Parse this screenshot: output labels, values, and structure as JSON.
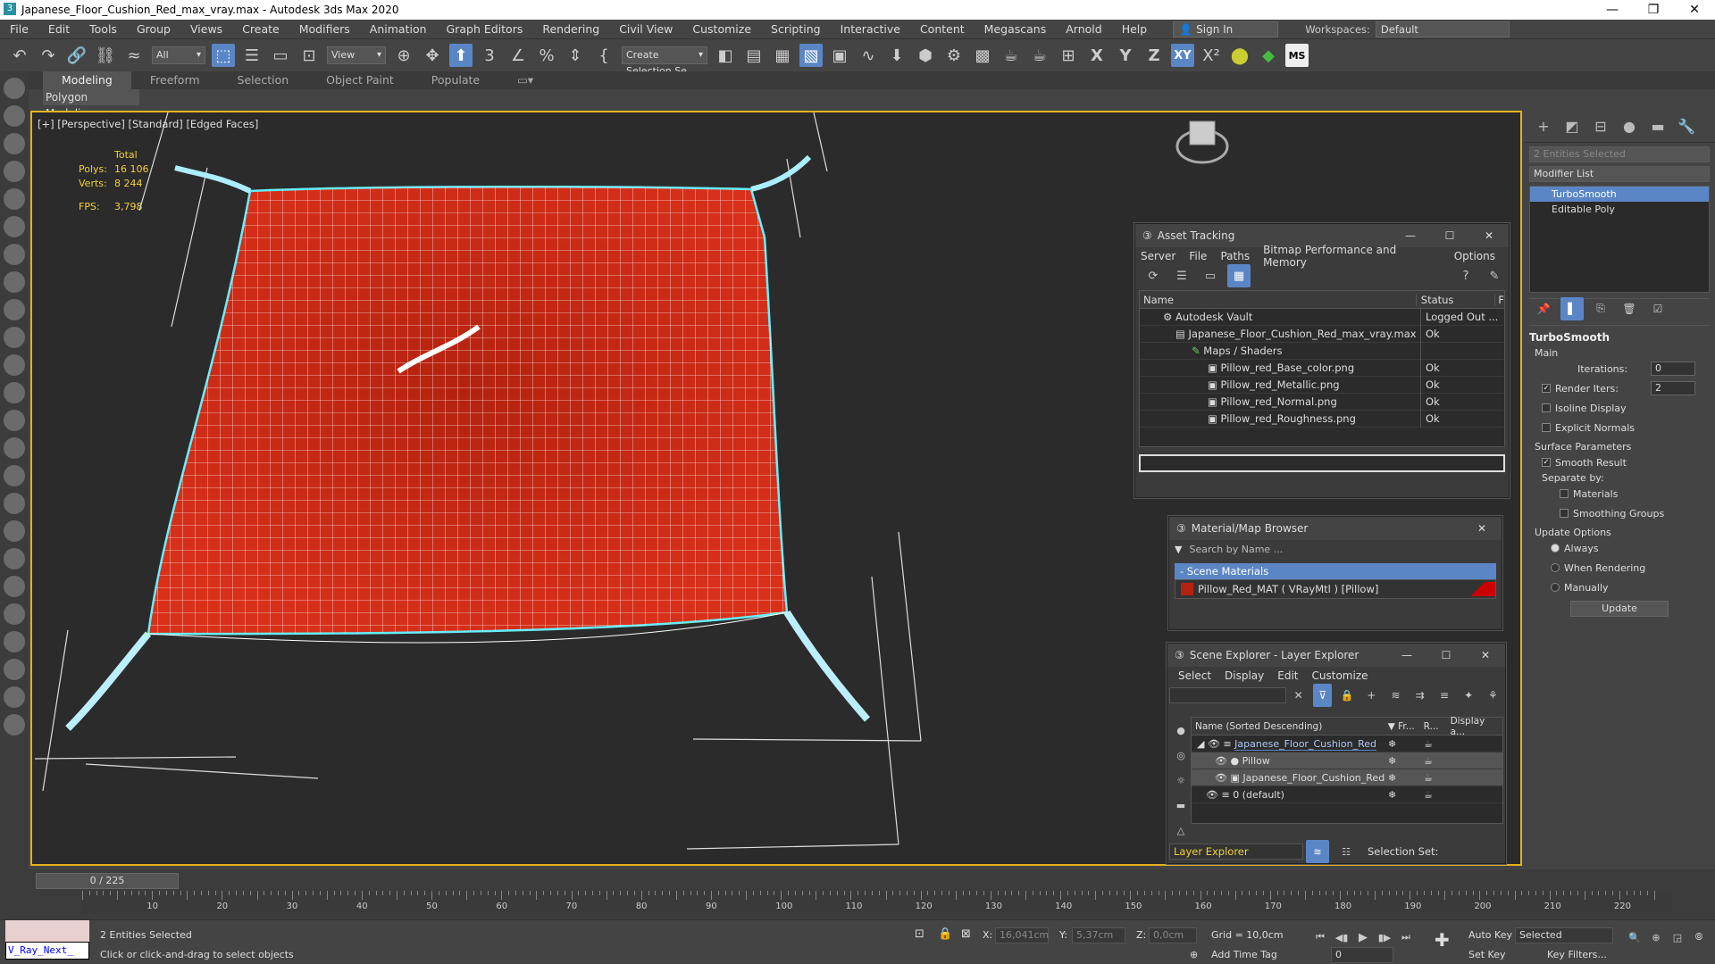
{
  "window": {
    "title": "Japanese_Floor_Cushion_Red_max_vray.max - Autodesk 3ds Max 2020"
  },
  "menu": [
    "File",
    "Edit",
    "Tools",
    "Group",
    "Views",
    "Create",
    "Modifiers",
    "Animation",
    "Graph Editors",
    "Rendering",
    "Civil View",
    "Customize",
    "Scripting",
    "Interactive",
    "Content",
    "Megascans",
    "Arnold",
    "Help"
  ],
  "signin": "Sign In",
  "workspace": {
    "label": "Workspaces:",
    "value": "Default"
  },
  "toolbar": {
    "filter": "All",
    "refcoord": "View",
    "selection_set": "Create Selection Se"
  },
  "ribbon": {
    "tabs": [
      "Modeling",
      "Freeform",
      "Selection",
      "Object Paint",
      "Populate"
    ],
    "sub": "Polygon Modeling"
  },
  "viewport": {
    "label": "[+] [Perspective] [Standard] [Edged Faces]",
    "stats": {
      "total": "Total",
      "polys_l": "Polys:",
      "polys": "16 106",
      "verts_l": "Verts:",
      "verts": "8 244",
      "fps_l": "FPS:",
      "fps": "3,798"
    }
  },
  "cmd": {
    "selected": "2 Entities Selected",
    "modlist": "Modifier List",
    "stack": [
      "TurboSmooth",
      "Editable Poly"
    ],
    "ts_title": "TurboSmooth",
    "main": "Main",
    "iterations_l": "Iterations:",
    "iterations": "0",
    "render_iters_l": "Render Iters:",
    "render_iters": "2",
    "isoline": "Isoline Display",
    "explicit": "Explicit Normals",
    "surface": "Surface Parameters",
    "smooth": "Smooth Result",
    "separate": "Separate by:",
    "materials": "Materials",
    "smoothing": "Smoothing Groups",
    "update_opts": "Update Options",
    "always": "Always",
    "when_rendering": "When Rendering",
    "manually": "Manually",
    "update": "Update"
  },
  "asset": {
    "title": "Asset Tracking",
    "menu": [
      "Server",
      "File",
      "Paths",
      "Bitmap Performance and Memory",
      "Options"
    ],
    "col_name": "Name",
    "col_status": "Status",
    "col_f": "F",
    "rows": [
      {
        "name": "Autodesk Vault",
        "status": "Logged Out ..."
      },
      {
        "name": "Japanese_Floor_Cushion_Red_max_vray.max",
        "status": "Ok"
      },
      {
        "name": "Maps / Shaders",
        "status": ""
      },
      {
        "name": "Pillow_red_Base_color.png",
        "status": "Ok"
      },
      {
        "name": "Pillow_red_Metallic.png",
        "status": "Ok"
      },
      {
        "name": "Pillow_red_Normal.png",
        "status": "Ok"
      },
      {
        "name": "Pillow_red_Roughness.png",
        "status": "Ok"
      }
    ]
  },
  "matbrowser": {
    "title": "Material/Map Browser",
    "search": "Search by Name ...",
    "group": "- Scene Materials",
    "item": "Pillow_Red_MAT ( VRayMtl ) [Pillow]"
  },
  "scene": {
    "title": "Scene Explorer - Layer Explorer",
    "menu": [
      "Select",
      "Display",
      "Edit",
      "Customize"
    ],
    "col_name": "Name (Sorted Descending)",
    "col_fr": "▼ Fr...",
    "col_r": "R...",
    "col_disp": "Display a...",
    "rows": [
      {
        "name": "Japanese_Floor_Cushion_Red"
      },
      {
        "name": "Pillow"
      },
      {
        "name": "Japanese_Floor_Cushion_Red"
      },
      {
        "name": "0 (default)"
      }
    ],
    "footer": "Layer Explorer",
    "selset": "Selection Set:"
  },
  "timeline": {
    "slider": "0 / 225",
    "labels": [
      "10",
      "20",
      "30",
      "40",
      "50",
      "60",
      "70",
      "80",
      "90",
      "100",
      "110",
      "120",
      "130",
      "140",
      "150",
      "160",
      "170",
      "180",
      "190",
      "200",
      "210",
      "220"
    ]
  },
  "status": {
    "script": "V_Ray_Next_",
    "selected": "2 Entities Selected",
    "hint": "Click or click-and-drag to select objects",
    "x_l": "X:",
    "x": "16,041cm",
    "y_l": "Y:",
    "y": "5,37cm",
    "z_l": "Z:",
    "z": "0,0cm",
    "grid": "Grid = 10,0cm",
    "addtag": "Add Time Tag",
    "frame": "0",
    "autokey": "Auto Key",
    "setkey": "Set Key",
    "selected_drop": "Selected",
    "keyfilters": "Key Filters..."
  }
}
